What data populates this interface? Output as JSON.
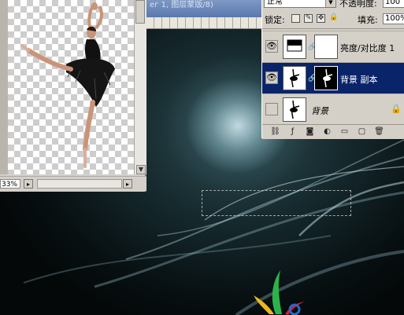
{
  "document_window": {
    "title_fragment": "ег 1, 图层蒙版/8)",
    "zoom_value": "33%"
  },
  "layers_panel": {
    "blend_mode": "正常",
    "opacity_label": "不透明度:",
    "opacity_value": "100",
    "lock_label": "锁定:",
    "fill_label": "填充:",
    "fill_value": "100%",
    "layers": [
      {
        "name": "亮度/对比度 1",
        "visible": true,
        "selected": false
      },
      {
        "name": "背景 副本",
        "visible": true,
        "selected": true
      },
      {
        "name": "背景",
        "visible": false,
        "selected": false,
        "locked": true
      }
    ],
    "icons": [
      "link-icon",
      "fx-icon",
      "mask-icon",
      "adjustment-icon",
      "folder-icon",
      "new-layer-icon",
      "trash-icon"
    ]
  },
  "colors": {
    "selection_blue": "#0a246a",
    "panel_gray": "#d4d0c8",
    "canvas_dark": "#0a1214"
  }
}
